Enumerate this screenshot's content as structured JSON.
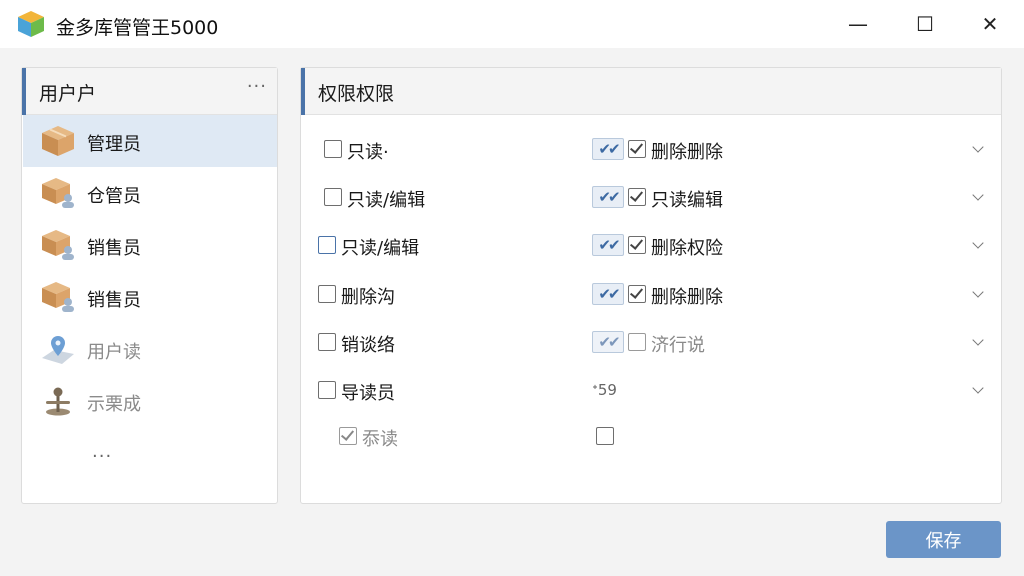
{
  "window": {
    "title": "金多库管管王5000",
    "minimize": "—",
    "maximize": "☐",
    "close": "✕"
  },
  "users": {
    "title": "用户户",
    "more": "···",
    "items": [
      {
        "label": "管理员",
        "icon": "box-icon",
        "selected": true
      },
      {
        "label": "仓管员",
        "icon": "box-user-icon"
      },
      {
        "label": "销售员",
        "icon": "box-user-icon"
      },
      {
        "label": "销售员",
        "icon": "box-user-icon"
      },
      {
        "label": "用户读",
        "icon": "map-pin-icon",
        "dim": true
      },
      {
        "label": "示栗成",
        "icon": "joystick-icon",
        "dim": true
      }
    ],
    "ellipsis": "···"
  },
  "permissions": {
    "title": "权限权限",
    "rows": [
      {
        "left": "只读·",
        "right": "删除删除",
        "right_checked": true
      },
      {
        "left": "只读/编辑",
        "right": "只读编辑",
        "right_checked": true
      },
      {
        "left": "只读/编辑",
        "right": "删除权险",
        "right_checked": true
      },
      {
        "left": "删除沟",
        "right": "删除删除",
        "right_checked": true
      },
      {
        "left": "销谈络",
        "right": "济行说",
        "right_checked": false
      },
      {
        "left": "导读员",
        "right": "",
        "extra": "ᐩ59"
      }
    ],
    "sub_row": {
      "label": "忝读",
      "checked": true
    },
    "double_check": "✔✔"
  },
  "actions": {
    "save": "保存"
  },
  "colors": {
    "accent": "#4a73a8",
    "save_button": "#6b95c8",
    "selected_row": "#dfe9f4"
  }
}
